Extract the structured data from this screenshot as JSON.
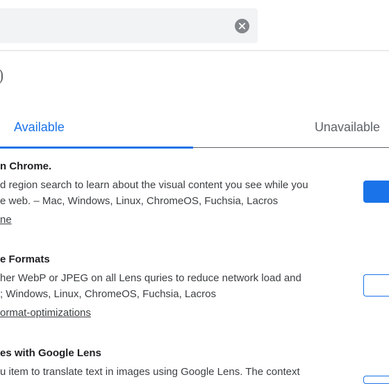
{
  "search": {
    "value": "",
    "clear_label": "clear"
  },
  "tabs": [
    {
      "label": "Available"
    },
    {
      "label": "Unavailable"
    }
  ],
  "experiments": [
    {
      "title": "n Chrome.",
      "desc_line1": "d region search to learn about the visual content you see while you",
      "desc_line2": "e web. – Mac, Windows, Linux, ChromeOS, Fuchsia, Lacros",
      "link": "ne",
      "state": "Enabled"
    },
    {
      "title": "e Formats",
      "desc_line1": "her WebP or JPEG on all Lens quries to reduce network load and",
      "desc_line2": "; Windows, Linux, ChromeOS, Fuchsia, Lacros",
      "link": "ormat-optimizations",
      "state": "Default"
    },
    {
      "title": "es with Google Lens",
      "desc_line1": "u item to translate text in images using Google Lens. The context",
      "state": "Default"
    }
  ],
  "colors": {
    "accent": "#1a73e8",
    "tab_inactive": "#5f6368",
    "text": "#202124"
  }
}
